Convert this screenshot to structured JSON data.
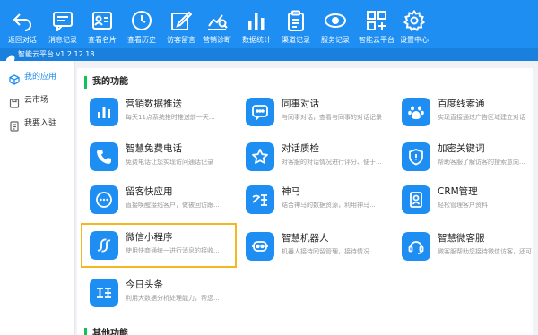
{
  "toolbar": {
    "items": [
      {
        "label": "返回对话",
        "icon": "back-arrow-icon"
      },
      {
        "label": "消息记录",
        "icon": "message-icon"
      },
      {
        "label": "查看名片",
        "icon": "contact-card-icon"
      },
      {
        "label": "查看历史",
        "icon": "clock-icon"
      },
      {
        "label": "访客留言",
        "icon": "edit-icon"
      },
      {
        "label": "营销诊断",
        "icon": "diagnosis-chart-icon"
      },
      {
        "label": "数据统计",
        "icon": "bar-chart-icon"
      },
      {
        "label": "渠道记录",
        "icon": "clipboard-icon"
      },
      {
        "label": "服务记录",
        "icon": "service-icon"
      },
      {
        "label": "智能云平台",
        "icon": "apps-grid-icon"
      },
      {
        "label": "设置中心",
        "icon": "gear-icon"
      }
    ]
  },
  "version_bar": {
    "text": "智能云平台 v1.2.12.18"
  },
  "sidebar": {
    "items": [
      {
        "label": "我的应用",
        "active": true,
        "icon": "cube-icon"
      },
      {
        "label": "云市场",
        "active": false,
        "icon": "store-icon"
      },
      {
        "label": "我要入驻",
        "active": false,
        "icon": "document-icon"
      }
    ]
  },
  "main": {
    "section_title": "我的功能",
    "section2_title": "其他功能",
    "apps": [
      {
        "title": "营销数据推送",
        "desc": "每天11点系统推时推送前一天...",
        "icon": "bar-chart-icon"
      },
      {
        "title": "同事对话",
        "desc": "与同事对话，查看与同事的对话记录",
        "icon": "chat-icon"
      },
      {
        "title": "百度线索通",
        "desc": "实现直接通过广告区域建立对话",
        "icon": "baidu-paw-icon"
      },
      {
        "title": "智慧免费电话",
        "desc": "免费电话让您实现访问通话记录",
        "icon": "phone-icon"
      },
      {
        "title": "对话质检",
        "desc": "对客服的对话情况进行评分、便于...",
        "icon": "star-icon"
      },
      {
        "title": "加密关键词",
        "desc": "帮助客服了解访客的搜索意向...",
        "icon": "shield-icon"
      },
      {
        "title": "留客快应用",
        "desc": "直接唤醒接线客户，做被回访跟...",
        "icon": "more-dots-icon"
      },
      {
        "title": "神马",
        "desc": "结合神马的数据资源，利用神马...",
        "icon": "shenma-logo-icon"
      },
      {
        "title": "CRM管理",
        "desc": "轻松管理客户资料",
        "icon": "badge-icon"
      },
      {
        "title": "微信小程序",
        "desc": "使用快商通统一进行消息的接收...",
        "icon": "link-s-icon",
        "highlight": true
      },
      {
        "title": "智慧机器人",
        "desc": "机器人接待同留管理，接待情况...",
        "icon": "robot-icon"
      },
      {
        "title": "智慧微客服",
        "desc": "微客服帮助您接待微信访客，还可...",
        "icon": "headset-icon"
      },
      {
        "title": "今日头条",
        "desc": "利用大数据分析处理能力，帮您...",
        "icon": "toutiao-logo-icon"
      }
    ]
  },
  "colors": {
    "primary": "#1e8ef2",
    "highlight": "#f5b71e",
    "section_accent": "#13c15a"
  }
}
